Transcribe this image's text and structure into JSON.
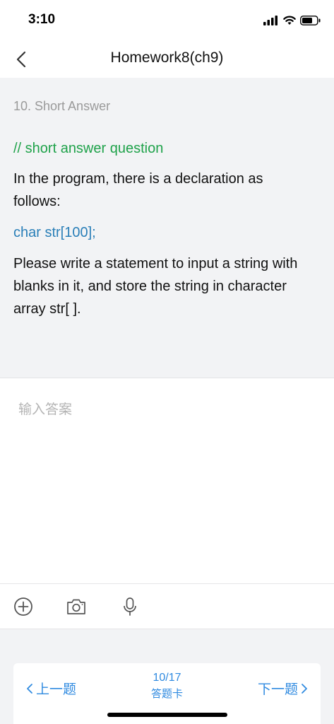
{
  "status_bar": {
    "time": "3:10"
  },
  "nav": {
    "title": "Homework8(ch9)"
  },
  "question": {
    "number": "10. Short Answer",
    "comment": "// short answer question",
    "text1": "In the program, there is a declaration as follows:",
    "code": "char str[100];",
    "text2": "Please write a statement to input a string with blanks in it, and store the string in character array str[ ]."
  },
  "answer": {
    "placeholder": "输入答案"
  },
  "toolbar": {
    "icons": [
      "plus-circle-icon",
      "camera-icon",
      "microphone-icon"
    ]
  },
  "footer": {
    "prev": "上一题",
    "next": "下一题",
    "progress": "10/17",
    "card": "答题卡"
  },
  "colors": {
    "accent": "#2f8ae0",
    "comment": "#1fa24a",
    "code": "#2a7fb8"
  }
}
